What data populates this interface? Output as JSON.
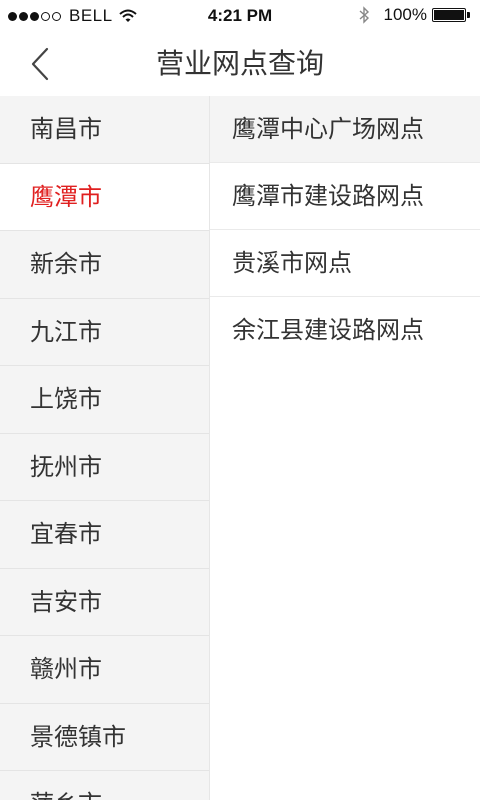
{
  "status_bar": {
    "carrier": "BELL",
    "time": "4:21 PM",
    "battery": "100%"
  },
  "nav": {
    "title": "营业网点查询"
  },
  "cities": [
    {
      "label": "南昌市"
    },
    {
      "label": "鹰潭市"
    },
    {
      "label": "新余市"
    },
    {
      "label": "九江市"
    },
    {
      "label": "上饶市"
    },
    {
      "label": "抚州市"
    },
    {
      "label": "宜春市"
    },
    {
      "label": "吉安市"
    },
    {
      "label": "赣州市"
    },
    {
      "label": "景德镇市"
    },
    {
      "label": "萍乡市"
    }
  ],
  "selected_city_index": 1,
  "branches": [
    {
      "label": "鹰潭中心广场网点"
    },
    {
      "label": "鹰潭市建设路网点"
    },
    {
      "label": "贵溪市网点"
    },
    {
      "label": "余江县建设路网点"
    }
  ],
  "colors": {
    "accent": "#e02020",
    "sidebar_bg": "#f4f4f4",
    "text": "#333333"
  }
}
